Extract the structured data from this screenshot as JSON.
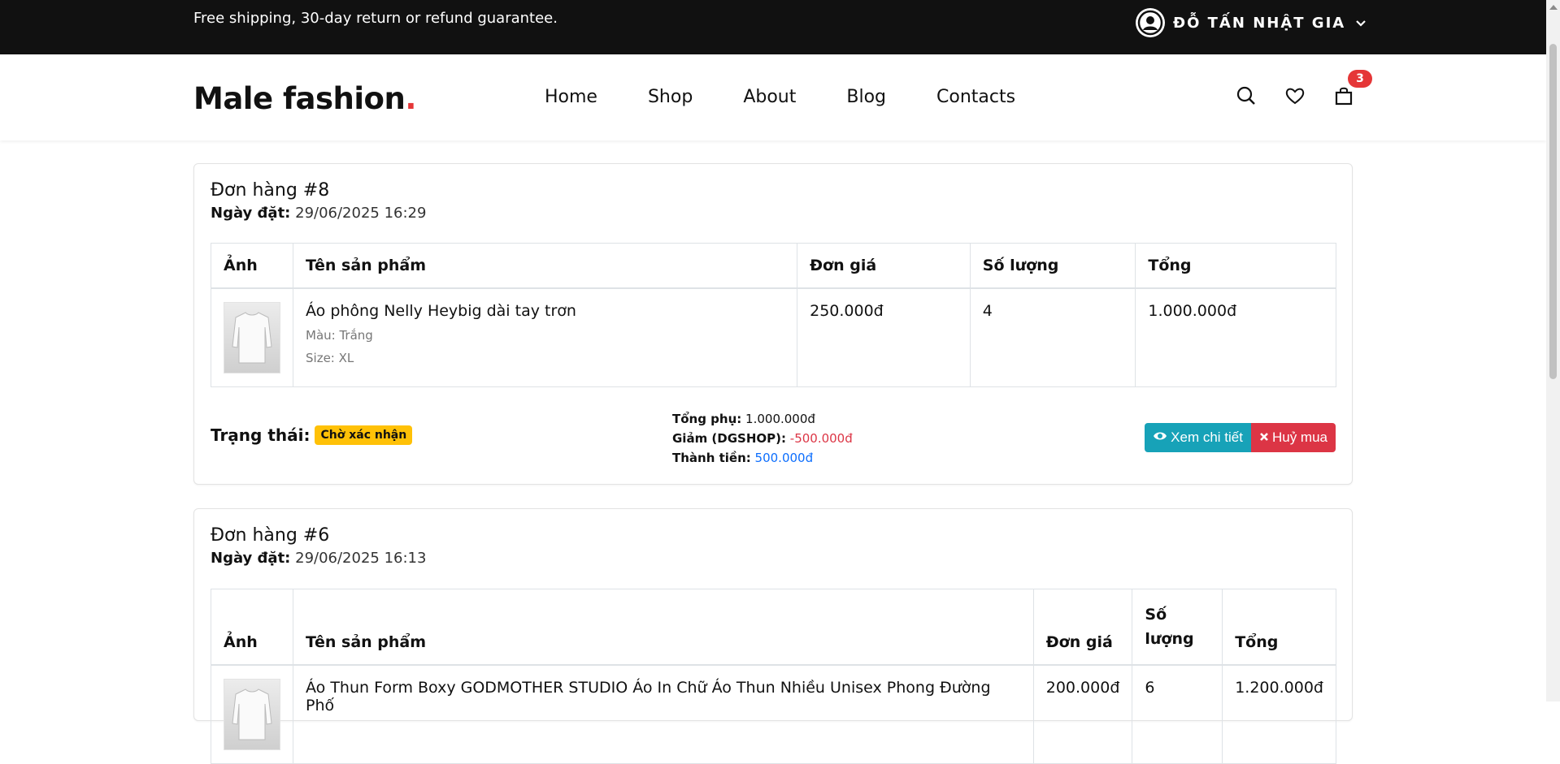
{
  "topbar": {
    "promo": "Free shipping, 30-day return or refund guarantee.",
    "user_name": "ĐỖ TẤN NHẬT GIA"
  },
  "header": {
    "logo_main": "Male fashion",
    "logo_dot": ".",
    "nav": [
      "Home",
      "Shop",
      "About",
      "Blog",
      "Contacts"
    ],
    "cart_count": "3"
  },
  "orders": [
    {
      "title": "Đơn hàng #8",
      "date_label": "Ngày đặt:",
      "date_value": " 29/06/2025 16:29",
      "columns": [
        "Ảnh",
        "Tên sản phẩm",
        "Đơn giá",
        "Số lượng",
        "Tổng"
      ],
      "items": [
        {
          "name": "Áo phông Nelly Heybig dài tay trơn",
          "color": "Màu: Trắng",
          "size": "Size: XL",
          "price": "250.000đ",
          "qty": "4",
          "total": "1.000.000đ"
        }
      ],
      "status_label": "Trạng thái:",
      "status_badge": "Chờ xác nhận",
      "subtotal_label": "Tổng phụ:",
      "subtotal": " 1.000.000đ",
      "discount_label": "Giảm (DGSHOP):",
      "discount": " -500.000đ",
      "final_label": "Thành tiền:",
      "final": " 500.000đ",
      "btn_detail": "Xem chi tiết",
      "btn_cancel": "Huỷ mua"
    },
    {
      "title": "Đơn hàng #6",
      "date_label": "Ngày đặt:",
      "date_value": " 29/06/2025 16:13",
      "columns": [
        "Ảnh",
        "Tên sản phẩm",
        "Đơn giá",
        "Số lượng",
        "Tổng"
      ],
      "items": [
        {
          "name": "Áo Thun Form Boxy GODMOTHER STUDIO Áo In Chữ Áo Thun Nhiều Unisex Phong Đường Phố",
          "price": "200.000đ",
          "qty": "6",
          "total": "1.200.000đ"
        }
      ]
    }
  ]
}
